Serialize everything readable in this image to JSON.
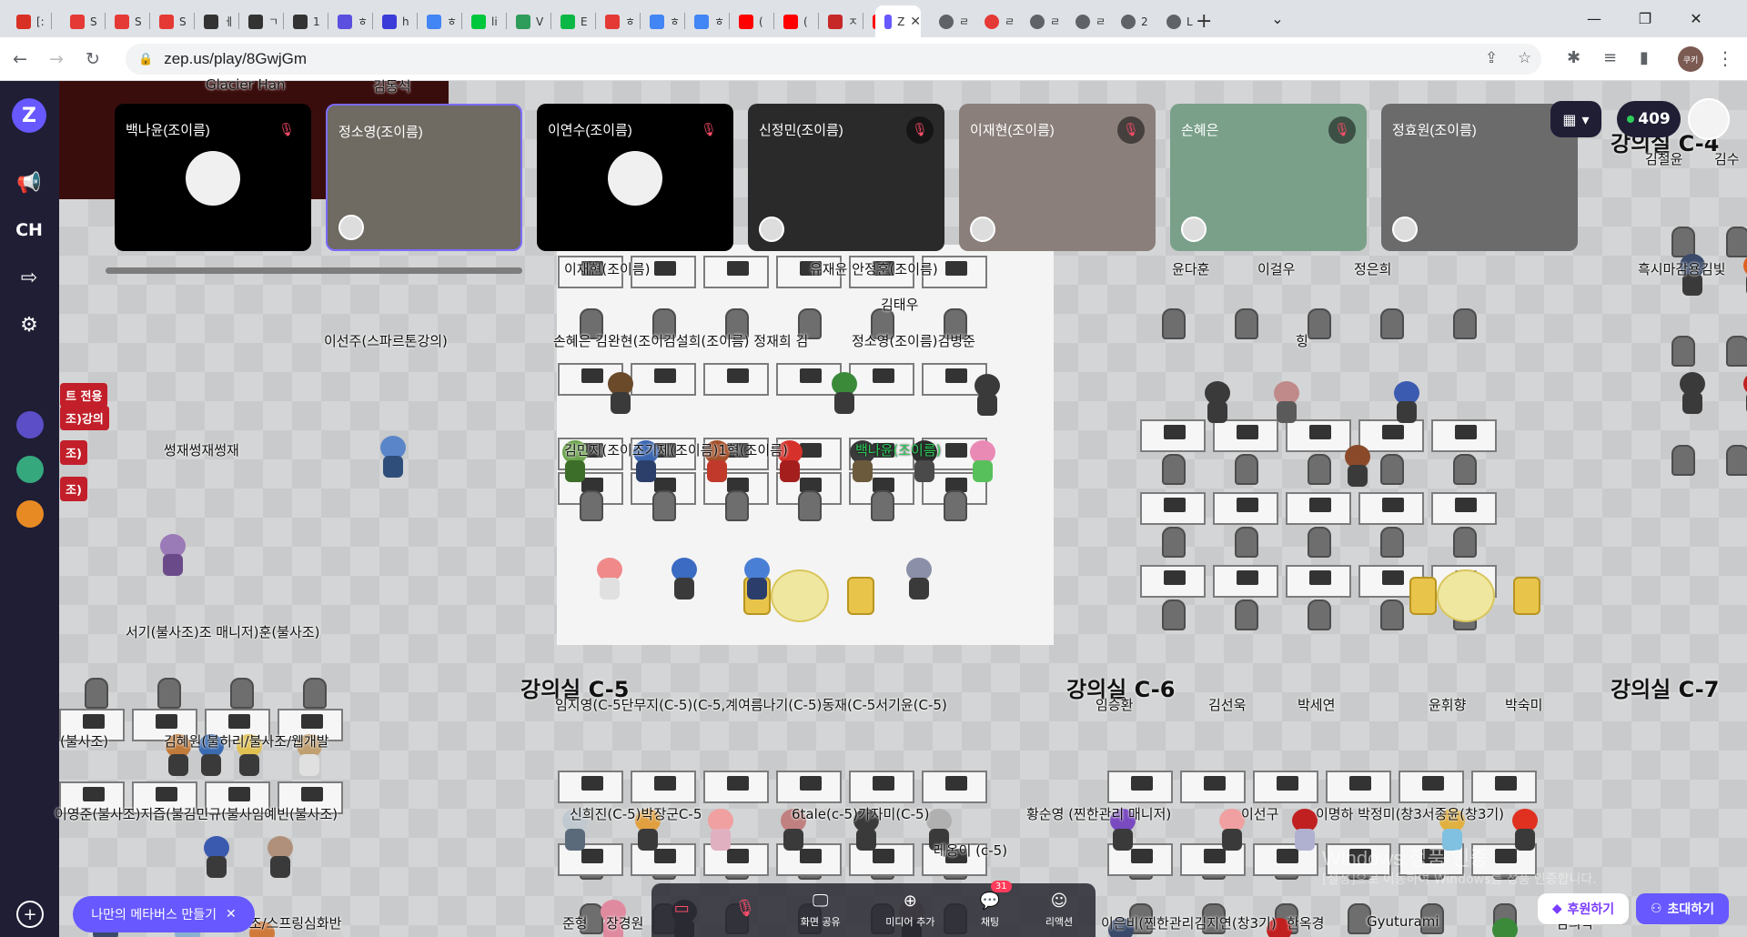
{
  "browser": {
    "tabs": [
      {
        "label": "[:",
        "color": "#d93025"
      },
      {
        "label": "S",
        "color": "#e53935"
      },
      {
        "label": "S",
        "color": "#e53935"
      },
      {
        "label": "S",
        "color": "#e53935"
      },
      {
        "label": "ㅔ",
        "color": "#333333"
      },
      {
        "label": "ㄱ",
        "color": "#333333"
      },
      {
        "label": "1",
        "color": "#333333"
      },
      {
        "label": "ㅎ",
        "color": "#5b4fe0"
      },
      {
        "label": "h",
        "color": "#3b3bd9"
      },
      {
        "label": "ㅎ",
        "color": "#4285f4"
      },
      {
        "label": "li",
        "color": "#00c73c"
      },
      {
        "label": "V",
        "color": "#2e9c5a"
      },
      {
        "label": "E",
        "color": "#0cb845"
      },
      {
        "label": "ㅎ",
        "color": "#e53935"
      },
      {
        "label": "ㅎ",
        "color": "#4285f4"
      },
      {
        "label": "ㅎ",
        "color": "#4285f4"
      },
      {
        "label": "(",
        "color": "#ff0000"
      },
      {
        "label": "(",
        "color": "#ff0000"
      },
      {
        "label": "ㅈ",
        "color": "#c62828"
      },
      {
        "label": "(",
        "color": "#ff0000"
      }
    ],
    "active_tab": {
      "label": "ZI",
      "color": "#6758ff"
    },
    "after_tabs": [
      {
        "label": "ㄹ",
        "color": "#5f6368"
      },
      {
        "label": "ㄹ",
        "color": "#e53935"
      },
      {
        "label": "ㄹ",
        "color": "#5f6368"
      },
      {
        "label": "ㄹ",
        "color": "#5f6368"
      },
      {
        "label": "2",
        "color": "#5f6368"
      },
      {
        "label": "L",
        "color": "#5f6368"
      }
    ],
    "new_tab": "+",
    "url": "zep.us/play/8GwjGm",
    "profile_label": "쿠키"
  },
  "sidebar": {
    "logo": "Z",
    "channel_label": "CH"
  },
  "videos": [
    {
      "name": "백나윤(조이름)",
      "muted": true,
      "camera": false
    },
    {
      "name": "정소영(조이름)",
      "muted": false,
      "camera": true,
      "selected": true
    },
    {
      "name": "이연수(조이름)",
      "muted": true,
      "camera": false
    },
    {
      "name": "신정민(조이름)",
      "muted": true,
      "camera": true
    },
    {
      "name": "이재현(조이름)",
      "muted": true,
      "camera": true
    },
    {
      "name": "손혜은",
      "muted": true,
      "camera": true
    },
    {
      "name": "정효원(조이름)",
      "muted": false,
      "camera": true
    }
  ],
  "topright": {
    "online_count": "409"
  },
  "rooms": {
    "c4": "강의실 C-4",
    "c5": "강의실 C-5",
    "c6": "강의실 C-6",
    "c7": "강의실 C-7"
  },
  "signs": [
    "트 전용",
    "조)강의",
    "조)",
    "조)"
  ],
  "labels": [
    "Glacier Han",
    "김동석",
    "이재현(조이름)",
    "유재윤 안정훈(조이름)",
    "김태우",
    "손혜은 김완현(조이김설희(조이름) 정재희 김",
    "정소영(조이름)김병준",
    "이선주(스파르톤강의)",
    "썽재썽재썽재",
    "김민지(조이조기제(조이름)1혁(조이름)",
    "윤다훈",
    "이걸우",
    "정은희",
    "힝",
    "김철윤",
    "김수",
    "흑시마감용김빛",
    "서기(불사조)조 매니저)훈(불사조)",
    "(불사조)",
    "김혜원(불히리/불사조/웹개발",
    "이영준(불사조)지즙(불김민규(불사임예빈(불사조)",
    "임지영(C-5단무지(C-5)(C-5,계여름나기(C-5)동재(C-5서기윤(C-5)",
    "신희진(C-5)박장군C-5",
    "6tale(c-5)가자미(C-5)",
    "레옹이 (c-5)",
    "임승환",
    "김선욱",
    "박세연",
    "윤휘향",
    "박숙미",
    "황순영 (찐한관리 매니저)",
    "이선구",
    "이명하 박정미(창3서종윤(창3기)",
    "준형",
    "장경원",
    "이은비(찐한관리김지연(창3기)",
    "한옥경",
    "Gyuturami",
    "김의탁",
    "사조/스프링심화반"
  ],
  "highlight_label": "백나윤(조이름)",
  "bottombar": [
    {
      "label": "",
      "icon": "camera-off",
      "red": true
    },
    {
      "label": "",
      "icon": "mic-off",
      "red": true
    },
    {
      "label": "화면 공유",
      "icon": "screen-share"
    },
    {
      "label": "미디어 추가",
      "icon": "add-media"
    },
    {
      "label": "채팅",
      "icon": "chat",
      "badge": "31"
    },
    {
      "label": "리액션",
      "icon": "reaction"
    }
  ],
  "buttons": {
    "my_metaverse": "나만의 메타버스 만들기",
    "sponsor": "후원하기",
    "invite": "초대하기"
  },
  "watermark": {
    "line1": "Windows 정품 인증",
    "line2": "[설정]으로 이동하여 Windows를 정품 인증합니다."
  }
}
